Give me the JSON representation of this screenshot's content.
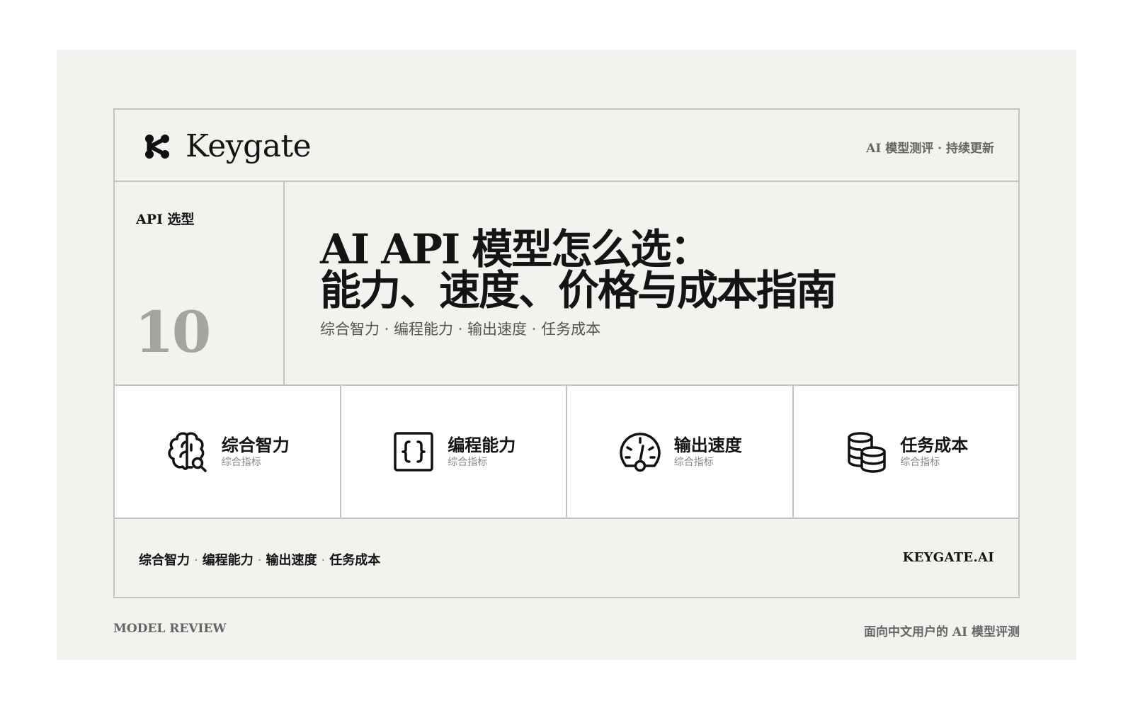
{
  "header": {
    "brand_name": "Keygate",
    "logo_icon": "keygate-logo-icon",
    "tagline": "AI 模型测评 · 持续更新"
  },
  "hero": {
    "kicker": "API 选型",
    "issue_number": "10",
    "title_line1": "AI API 模型怎么选：",
    "title_line2": "能力、速度、价格与成本指南",
    "subtitle": "综合智力 · 编程能力 · 输出速度 · 任务成本"
  },
  "features": [
    {
      "icon": "brain-search-icon",
      "title": "综合智力",
      "caption": "综合指标"
    },
    {
      "icon": "code-braces-icon",
      "title": "编程能力",
      "caption": "综合指标"
    },
    {
      "icon": "speedometer-icon",
      "title": "输出速度",
      "caption": "综合指标"
    },
    {
      "icon": "coins-stack-icon",
      "title": "任务成本",
      "caption": "综合指标"
    }
  ],
  "footer": {
    "topics": [
      "综合智力",
      "编程能力",
      "输出速度",
      "任务成本"
    ],
    "topic_separator": "·",
    "site": "KEYGATE.AI"
  },
  "captions": {
    "left": "MODEL REVIEW",
    "right": "面向中文用户的 AI 模型评测"
  },
  "colors": {
    "background": "#f3f2ef",
    "feature_background": "#ffffff",
    "border": "#c3c3c0",
    "text": "#141414",
    "muted_text": "#666666",
    "issue_number": "#a5a4a0"
  }
}
